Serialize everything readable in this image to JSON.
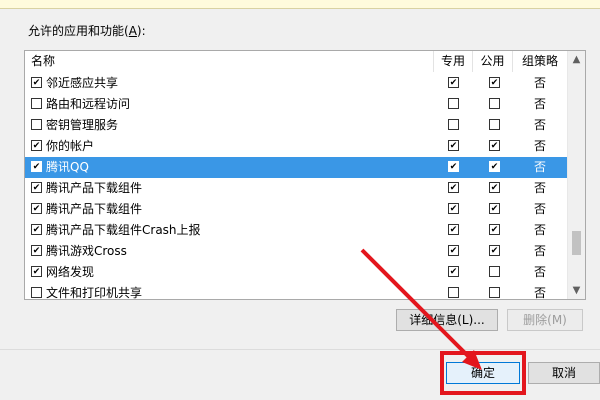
{
  "list_label": {
    "text": "允许的应用和功能(",
    "hotkey": "A",
    "suffix": "):"
  },
  "columns": {
    "name": "名称",
    "private": "专用",
    "public": "公用",
    "group_policy": "组策略"
  },
  "rows": [
    {
      "name": "邻近感应共享",
      "enabled": true,
      "private": true,
      "public": true,
      "group_policy": "否",
      "selected": false
    },
    {
      "name": "路由和远程访问",
      "enabled": false,
      "private": false,
      "public": false,
      "group_policy": "否",
      "selected": false
    },
    {
      "name": "密钥管理服务",
      "enabled": false,
      "private": false,
      "public": false,
      "group_policy": "否",
      "selected": false
    },
    {
      "name": "你的帐户",
      "enabled": true,
      "private": true,
      "public": true,
      "group_policy": "否",
      "selected": false
    },
    {
      "name": "腾讯QQ",
      "enabled": true,
      "private": true,
      "public": true,
      "group_policy": "否",
      "selected": true
    },
    {
      "name": "腾讯产品下载组件",
      "enabled": true,
      "private": true,
      "public": true,
      "group_policy": "否",
      "selected": false
    },
    {
      "name": "腾讯产品下载组件",
      "enabled": true,
      "private": true,
      "public": true,
      "group_policy": "否",
      "selected": false
    },
    {
      "name": "腾讯产品下载组件Crash上报",
      "enabled": true,
      "private": true,
      "public": true,
      "group_policy": "否",
      "selected": false
    },
    {
      "name": "腾讯游戏Cross",
      "enabled": true,
      "private": true,
      "public": true,
      "group_policy": "否",
      "selected": false
    },
    {
      "name": "网络发现",
      "enabled": true,
      "private": true,
      "public": false,
      "group_policy": "否",
      "selected": false
    },
    {
      "name": "文件和打印机共享",
      "enabled": false,
      "private": false,
      "public": false,
      "group_policy": "否",
      "selected": false
    }
  ],
  "buttons": {
    "details": "详细信息(L)...",
    "delete": "删除(M)",
    "ok": "确定",
    "cancel": "取消"
  },
  "icons": {
    "scroll_up": "chevron-up-icon",
    "scroll_down": "chevron-down-icon",
    "annotation": "red-arrow"
  },
  "colors": {
    "selection": "#3a97e6",
    "annotation": "#e3161d"
  }
}
